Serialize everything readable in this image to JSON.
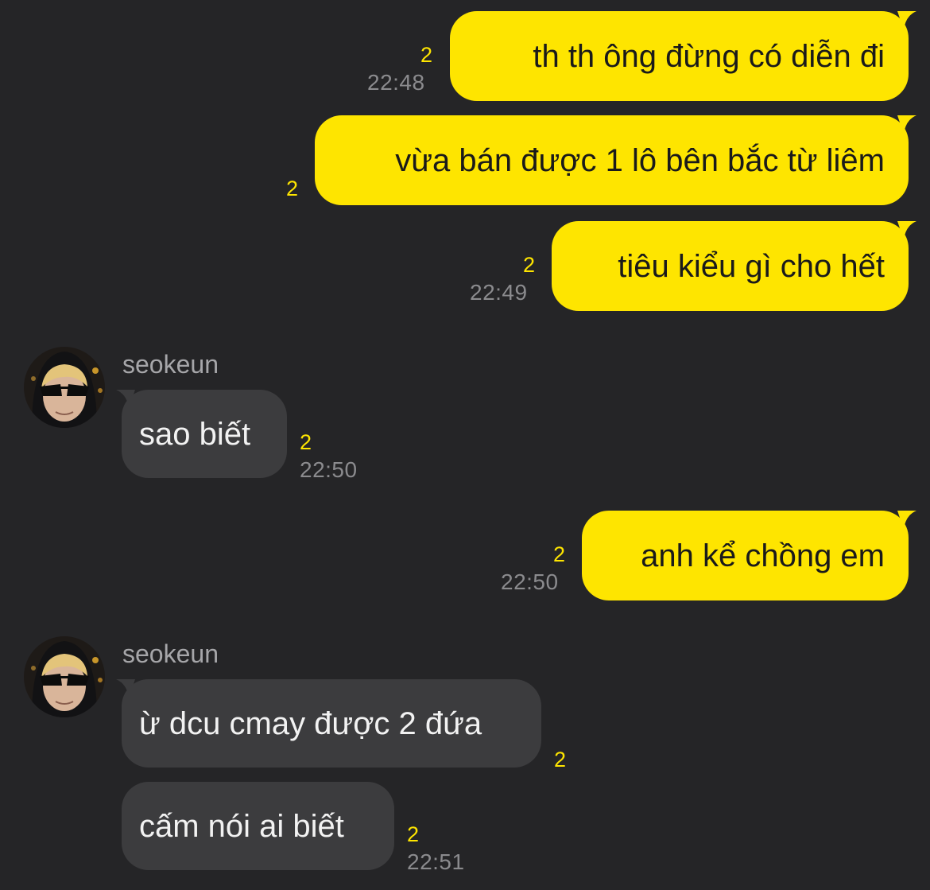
{
  "colors": {
    "background": "#252527",
    "outgoing_bubble": "#fee500",
    "incoming_bubble": "#3c3c3e",
    "unread_count": "#fee500",
    "timestamp": "#8b8b8e"
  },
  "messages": [
    {
      "direction": "out",
      "text": "th th ông đừng có diễn đi",
      "unread": "2",
      "time": "22:48"
    },
    {
      "direction": "out",
      "text": "vừa bán được 1 lô bên bắc từ liêm",
      "unread": "2",
      "time": ""
    },
    {
      "direction": "out",
      "text": "tiêu kiểu gì cho hết",
      "unread": "2",
      "time": "22:49"
    },
    {
      "direction": "in",
      "sender": "seokeun",
      "avatar_icon": "profile-photo",
      "text": "sao biết",
      "unread": "2",
      "time": "22:50"
    },
    {
      "direction": "out",
      "text": "anh kể chồng em",
      "unread": "2",
      "time": "22:50"
    },
    {
      "direction": "in",
      "sender": "seokeun",
      "avatar_icon": "profile-photo",
      "text": "ừ dcu cmay được 2 đứa",
      "unread": "2",
      "time": ""
    },
    {
      "direction": "in",
      "text": "cấm nói ai biết",
      "unread": "2",
      "time": "22:51"
    }
  ]
}
